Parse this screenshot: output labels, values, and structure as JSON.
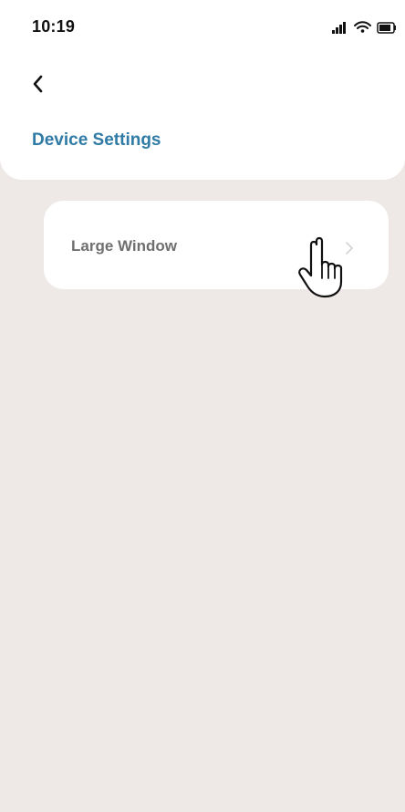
{
  "status_bar": {
    "time": "10:19",
    "icons": [
      "signal-icon",
      "wifi-icon",
      "battery-icon"
    ]
  },
  "header": {
    "back_icon": "chevron-left-icon",
    "title": "Device Settings"
  },
  "settings": {
    "items": [
      {
        "label": "Large Window",
        "icon": "chevron-right-icon"
      }
    ]
  },
  "cursor": {
    "icon": "hand-pointer-icon"
  },
  "colors": {
    "background": "#eee9e7",
    "panel": "#ffffff",
    "title": "#2f7ba6",
    "label": "#6f6f6f"
  }
}
